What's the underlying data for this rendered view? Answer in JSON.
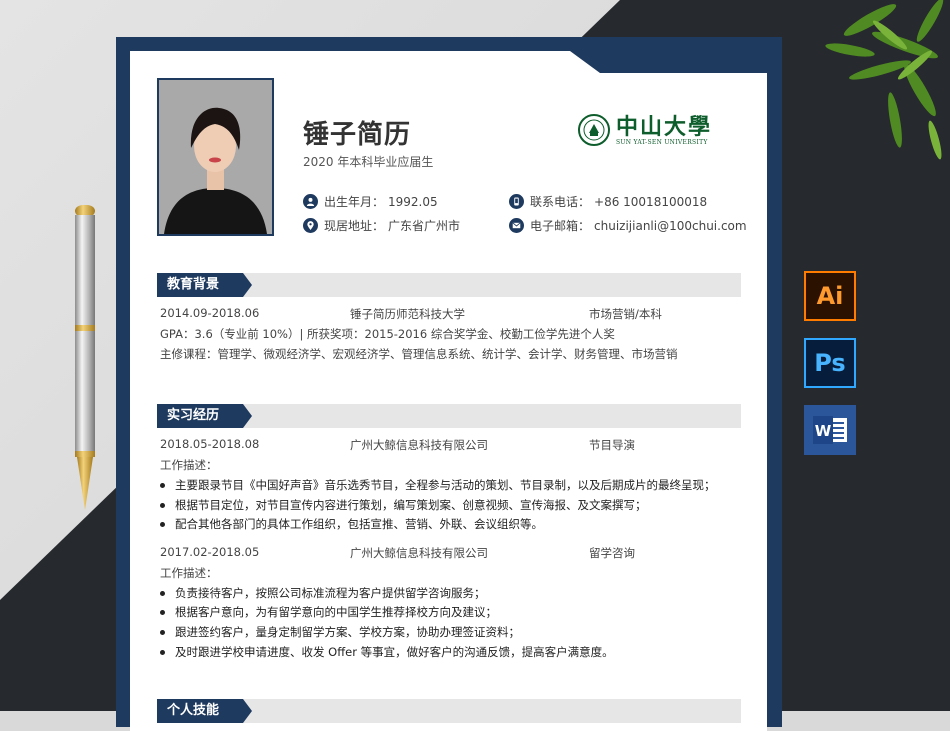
{
  "header": {
    "name": "锤子简历",
    "subtitle": "2020 年本科毕业应届生",
    "logo_cn": "中山大學",
    "logo_en": "SUN YAT-SEN UNIVERSITY"
  },
  "info": [
    {
      "icon": "person-icon",
      "label": "出生年月：",
      "value": "1992.05"
    },
    {
      "icon": "phone-icon",
      "label": "联系电话：",
      "value": "+86 10018100018"
    },
    {
      "icon": "location-icon",
      "label": "现居地址：",
      "value": "广东省广州市"
    },
    {
      "icon": "mail-icon",
      "label": "电子邮箱：",
      "value": "chuizijianli@100chui.com"
    }
  ],
  "education": {
    "title": "教育背景",
    "date": "2014.09-2018.06",
    "school": "锤子简历师范科技大学",
    "major": "市场营销/本科",
    "gpa": "GPA：3.6（专业前 10%）| 所获奖项：2015-2016 综合奖学金、校勤工俭学先进个人奖",
    "courses": "主修课程：管理学、微观经济学、宏观经济学、管理信息系统、统计学、会计学、财务管理、市场营销"
  },
  "internship": {
    "title": "实习经历",
    "jobs": [
      {
        "date": "2018.05-2018.08",
        "company": "广州大鲸信息科技有限公司",
        "role": "节目导演",
        "desc_label": "工作描述：",
        "bullets": [
          "主要跟录节目《中国好声音》音乐选秀节目，全程参与活动的策划、节目录制，以及后期成片的最终呈现；",
          "根据节目定位，对节目宣传内容进行策划，编写策划案、创意视频、宣传海报、及文案撰写；",
          "配合其他各部门的具体工作组织，包括宣推、营销、外联、会议组织等。"
        ]
      },
      {
        "date": "2017.02-2018.05",
        "company": "广州大鲸信息科技有限公司",
        "role": "留学咨询",
        "desc_label": "工作描述：",
        "bullets": [
          "负责接待客户，按照公司标准流程为客户提供留学咨询服务；",
          "根据客户意向，为有留学意向的中国学生推荐择校方向及建议；",
          "跟进签约客户，量身定制留学方案、学校方案，协助办理签证资料；",
          "及时跟进学校申请进度、收发 Offer 等事宜，做好客户的沟通反馈，提高客户满意度。"
        ]
      }
    ]
  },
  "skills": {
    "title": "个人技能"
  },
  "app_icons": [
    "Ai",
    "Ps",
    "W"
  ],
  "colors": {
    "navy": "#1f3a5f",
    "logo_green": "#0e5d2c",
    "section_gray": "#e6e6e6"
  }
}
